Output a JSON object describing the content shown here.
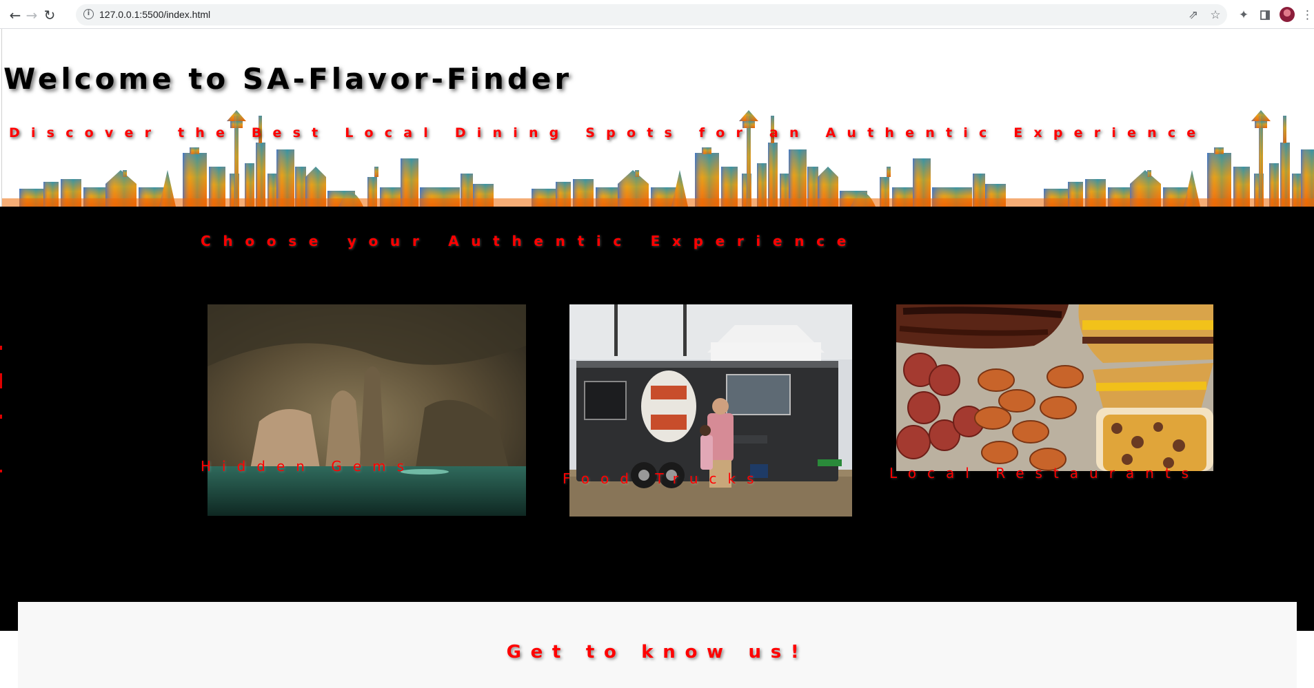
{
  "browser": {
    "url": "127.0.0.1:5500/index.html",
    "icons": {
      "back": "arrow-left-icon",
      "forward": "arrow-right-icon",
      "reload": "reload-icon",
      "site_info": "info-icon",
      "share": "share-icon",
      "bookmark": "star-icon",
      "extensions": "puzzle-icon",
      "side_panel": "side-panel-icon",
      "menu": "kebab-menu-icon"
    }
  },
  "hero": {
    "title": "Welcome to SA-Flavor-Finder",
    "subtitle": "Discover the Best Local Dining Spots for an Authentic Experience",
    "title_color": "#000000",
    "subtitle_color": "#ff0000"
  },
  "experiences": {
    "heading": "Choose your Authentic Experience",
    "background": "#000000",
    "label_color": "#ff0000",
    "cards": [
      {
        "label": "Hidden Gems",
        "image": "cave-photo"
      },
      {
        "label": "Food Trucks",
        "image": "food-truck-photo"
      },
      {
        "label": "Local Restaurants",
        "image": "bbq-platter-photo"
      }
    ]
  },
  "about": {
    "heading": "Get to know us!",
    "background": "#f8f8f8"
  }
}
